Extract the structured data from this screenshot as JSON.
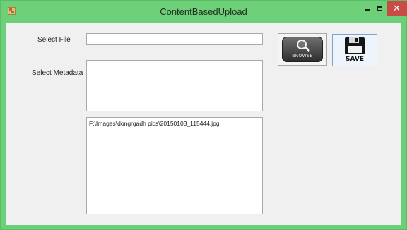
{
  "window": {
    "title": "ContentBasedUpload",
    "app_icon": "app-icon",
    "controls": {
      "minimize_icon": "minimize-icon",
      "maximize_icon": "maximize-icon",
      "close_glyph": "✕"
    },
    "colors": {
      "frame": "#6dcf78",
      "client": "#f0f0f0",
      "close": "#c94b45"
    }
  },
  "form": {
    "select_file_label": "Select File",
    "select_file_value": "",
    "select_metadata_label": "Select Metadata",
    "metadata_value": "",
    "path_text": "F:\\Images\\dongrgadh pics\\20150103_115444.jpg"
  },
  "buttons": {
    "browse": {
      "text": "BROWSE",
      "icon": "magnifier-icon"
    },
    "save": {
      "text": "SAVE",
      "icon": "floppy-disk-icon"
    }
  }
}
